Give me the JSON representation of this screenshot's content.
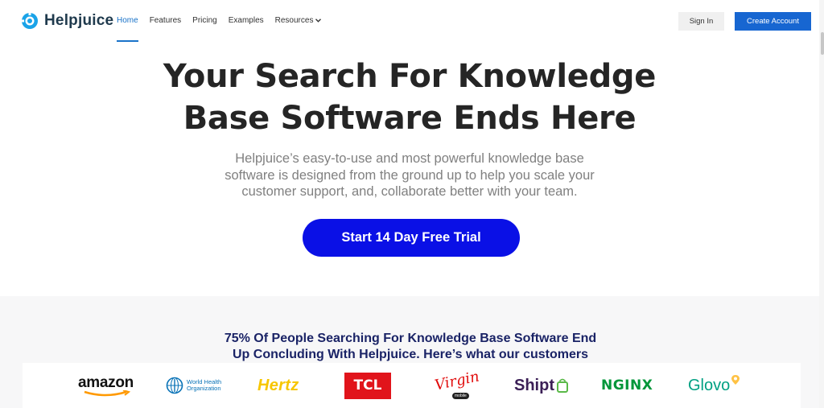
{
  "brand": {
    "name": "Helpjuice"
  },
  "nav": {
    "items": [
      {
        "label": "Home",
        "active": true
      },
      {
        "label": "Features"
      },
      {
        "label": "Pricing"
      },
      {
        "label": "Examples"
      },
      {
        "label": "Resources",
        "has_dropdown": true
      }
    ],
    "sign_in": "Sign In",
    "create_account": "Create Account"
  },
  "hero": {
    "title_line1": "Your Search For Knowledge",
    "title_line2": "Base Software Ends Here",
    "subtitle_line1": "Helpjuice’s easy-to-use and most powerful knowledge base",
    "subtitle_line2": "software is designed from the ground up to help you scale your",
    "subtitle_line3": "customer support, and, collaborate better with your team.",
    "cta": "Start 14 Day Free Trial"
  },
  "customers": {
    "heading_line1": "75% Of People Searching For Knowledge Base Software End",
    "heading_line2": "Up Concluding With Helpjuice. Here’s what our customers",
    "logos": [
      {
        "name": "amazon"
      },
      {
        "name": "World Health Organization",
        "line1": "World Health",
        "line2": "Organization"
      },
      {
        "name": "Hertz"
      },
      {
        "name": "TCL"
      },
      {
        "name": "Virgin",
        "sub": "mobile"
      },
      {
        "name": "Shipt"
      },
      {
        "name": "NGINX"
      },
      {
        "name": "Glovo"
      }
    ]
  },
  "colors": {
    "accent": "#1766d1",
    "cta": "#0a10e6",
    "heading_dark": "#1a2366",
    "nginx_green": "#009639",
    "glovo_green": "#00a082",
    "glovo_yellow": "#ffc244",
    "hertz_yellow": "#f7c600",
    "tcl_red": "#e1141b",
    "virgin_red": "#e10a0a",
    "shipt_purple": "#3b1f56"
  }
}
